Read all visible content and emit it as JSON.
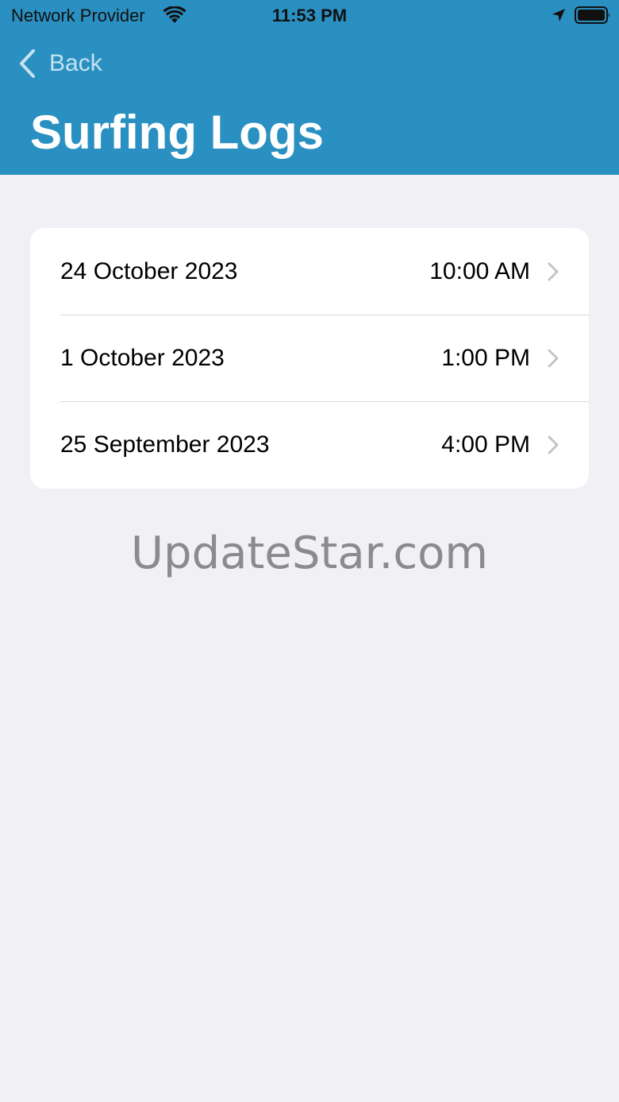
{
  "status_bar": {
    "carrier": "Network Provider",
    "time": "11:53 PM",
    "icons": [
      "wifi-icon",
      "location-arrow-icon",
      "battery-icon"
    ]
  },
  "nav": {
    "back_label": "Back",
    "back_icon": "chevron-left-icon",
    "title": "Surfing Logs"
  },
  "logs": [
    {
      "date": "24 October 2023",
      "time": "10:00 AM"
    },
    {
      "date": "1 October 2023",
      "time": "1:00 PM"
    },
    {
      "date": "25 September 2023",
      "time": "4:00 PM"
    }
  ],
  "watermark": "UpdateStar.com",
  "colors": {
    "header": "#2a90c1",
    "background": "#f0f0f5",
    "card": "#ffffff",
    "back_text": "#c5e2f1",
    "chevron": "#c4c4c7"
  }
}
